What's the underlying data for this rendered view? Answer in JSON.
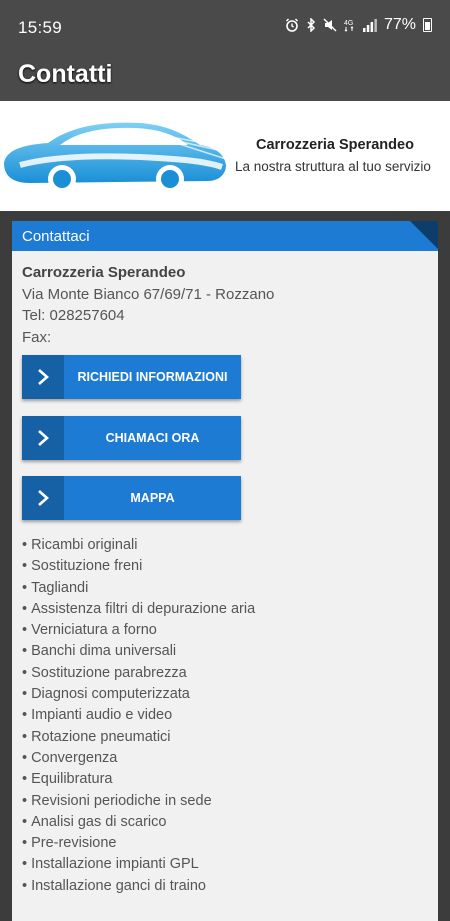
{
  "status_bar": {
    "time": "15:59",
    "battery": "77%",
    "icons": [
      "alarm-icon",
      "bluetooth-icon",
      "mute-icon",
      "4g-icon",
      "signal-icon",
      "battery-icon"
    ]
  },
  "app_bar": {
    "title": "Contatti"
  },
  "banner": {
    "company_name": "Carrozzeria Sperandeo",
    "tagline": "La nostra struttura al tuo servizio"
  },
  "card": {
    "header": "Contattaci",
    "company": "Carrozzeria Sperandeo",
    "address": "Via Monte Bianco 67/69/71 - Rozzano",
    "tel": "Tel: 028257604",
    "fax": "Fax:",
    "buttons": [
      {
        "label": "RICHIEDI INFORMAZIONI"
      },
      {
        "label": "CHIAMACI ORA"
      },
      {
        "label": "MAPPA"
      }
    ],
    "services": [
      "Ricambi originali",
      "Sostituzione freni",
      "Tagliandi",
      "Assistenza filtri di depurazione aria",
      "Verniciatura a forno",
      "Banchi dima universali",
      "Sostituzione parabrezza",
      "Diagnosi computerizzata",
      "Impianti audio e video",
      "Rotazione pneumatici",
      "Convergenza",
      "Equilibratura",
      "Revisioni periodiche in sede",
      "Analisi gas di scarico",
      "Pre-revisione",
      "Installazione impianti GPL",
      "Installazione ganci di traino"
    ]
  },
  "colors": {
    "accent": "#1d7bd3",
    "accent_dark": "#1660a6",
    "bar": "#4a4a4a"
  }
}
